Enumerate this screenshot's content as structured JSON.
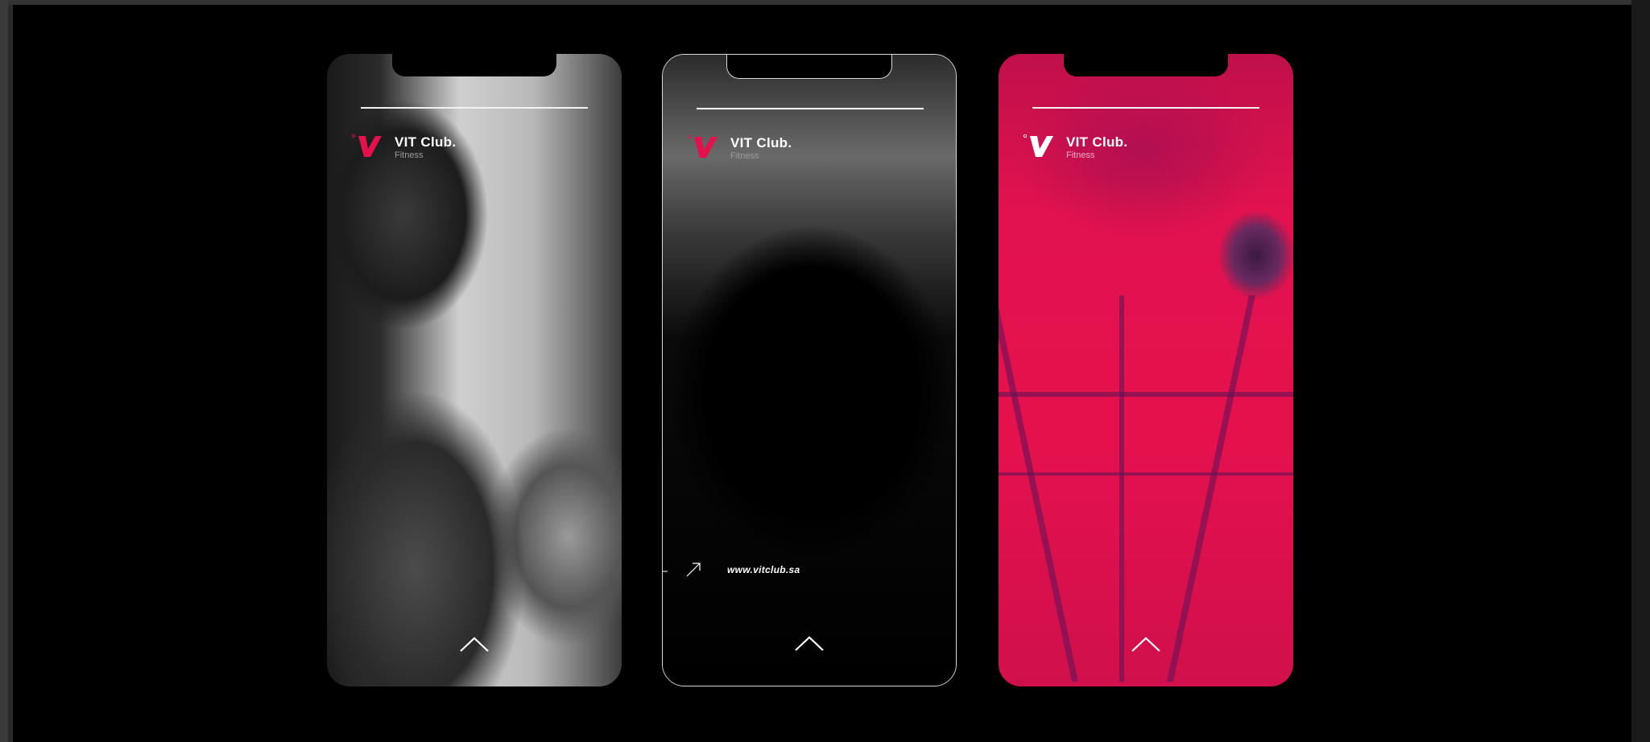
{
  "colors": {
    "background": "#000000",
    "accent": "#e5114d",
    "text": "#ffffff",
    "muted": "#9a9a9a"
  },
  "screens": [
    {
      "brand_name": "VIT Club.",
      "brand_sub": "Fitness",
      "photo": "woman-in-hijab-grayscale",
      "icons": [
        "vit-logo-icon",
        "chevron-up-icon"
      ]
    },
    {
      "brand_name": "VIT Club.",
      "brand_sub": "Fitness",
      "url": "www.vitclub.sa",
      "photo": "silhouette-dark",
      "icons": [
        "vit-logo-icon",
        "arrow-up-right-icon",
        "chevron-up-icon"
      ]
    },
    {
      "brand_name": "VIT Club.",
      "brand_sub": "Fitness",
      "photo": "woman-in-gym-duotone-red",
      "icons": [
        "vit-logo-icon",
        "chevron-up-icon"
      ]
    }
  ]
}
